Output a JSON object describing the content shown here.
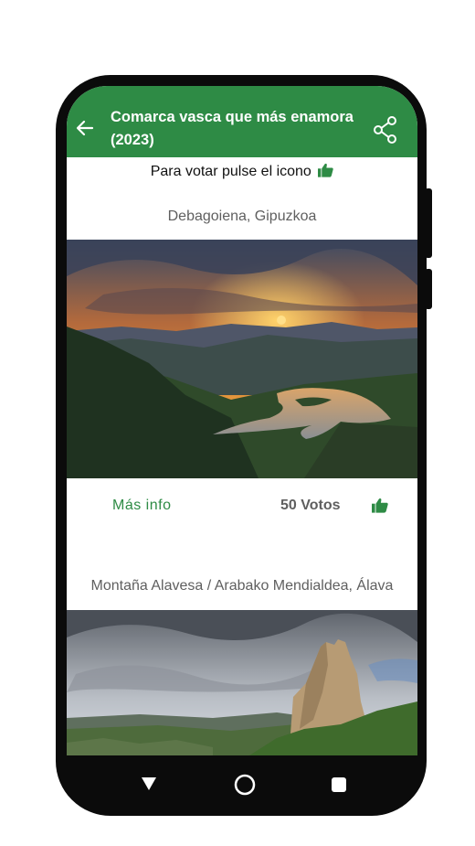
{
  "appbar": {
    "title": "Comarca vasca que más enamora (2023)",
    "back_icon": "arrow-left-icon",
    "share_icon": "share-icon",
    "color": "#2e8b45"
  },
  "hint": {
    "text": "Para votar pulse el icono",
    "icon": "thumbs-up-icon"
  },
  "cards": [
    {
      "location": "Debagoiena, Gipuzkoa",
      "more_info_label": "Más info",
      "votes_label": "50 Votos",
      "vote_icon": "thumbs-up-icon"
    },
    {
      "location": "Montaña Alavesa / Arabako Mendialdea, Álava"
    }
  ],
  "navbar": {
    "back_icon": "triangle-back-icon",
    "home_icon": "circle-home-icon",
    "recent_icon": "square-recents-icon"
  }
}
